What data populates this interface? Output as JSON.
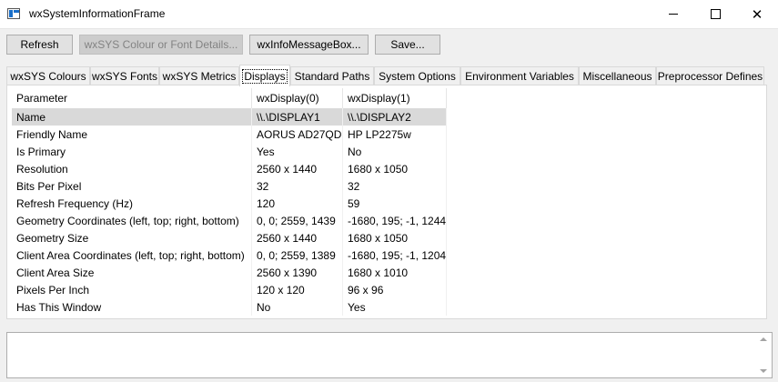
{
  "window": {
    "title": "wxSystemInformationFrame"
  },
  "toolbar": {
    "refresh": "Refresh",
    "colour_font_details": "wxSYS Colour or Font Details...",
    "info_message_box": "wxInfoMessageBox...",
    "save": "Save..."
  },
  "tabs": [
    "wxSYS Colours",
    "wxSYS Fonts",
    "wxSYS Metrics",
    "Displays",
    "Standard Paths",
    "System Options",
    "Environment Variables",
    "Miscellaneous",
    "Preprocessor Defines"
  ],
  "active_tab": "Displays",
  "table": {
    "columns": [
      "Parameter",
      "wxDisplay(0)",
      "wxDisplay(1)"
    ],
    "rows": [
      [
        "Name",
        "\\\\.\\DISPLAY1",
        "\\\\.\\DISPLAY2"
      ],
      [
        "Friendly Name",
        "AORUS AD27QD",
        "HP LP2275w"
      ],
      [
        "Is Primary",
        "Yes",
        "No"
      ],
      [
        "Resolution",
        "2560 x 1440",
        "1680 x 1050"
      ],
      [
        "Bits Per Pixel",
        "32",
        "32"
      ],
      [
        "Refresh Frequency (Hz)",
        "120",
        "59"
      ],
      [
        "Geometry Coordinates (left, top; right, bottom)",
        "0, 0; 2559, 1439",
        "-1680, 195; -1, 1244"
      ],
      [
        "Geometry Size",
        "2560 x 1440",
        "1680 x 1050"
      ],
      [
        "Client Area Coordinates (left, top; right, bottom)",
        "0, 0; 2559, 1389",
        "-1680, 195; -1, 1204"
      ],
      [
        "Client Area Size",
        "2560 x 1390",
        "1680 x 1010"
      ],
      [
        "Pixels Per Inch",
        "120 x 120",
        "96 x 96"
      ],
      [
        "Has This Window",
        "No",
        "Yes"
      ]
    ],
    "selected_row": 0
  },
  "log": {
    "text": ""
  }
}
